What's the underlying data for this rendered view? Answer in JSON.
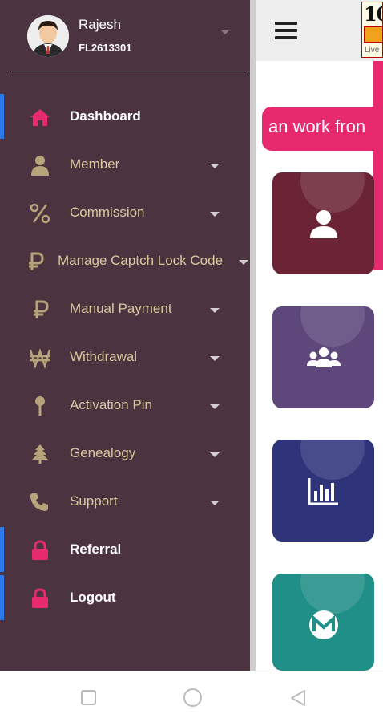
{
  "user": {
    "name": "Rajesh",
    "id": "FL2613301"
  },
  "marquee_text": "an work fron",
  "logo": {
    "text": "10",
    "subtext": "Live"
  },
  "menu": [
    {
      "label": "Dashboard",
      "icon": "home-icon",
      "active": true,
      "caret": false
    },
    {
      "label": "Member",
      "icon": "user-icon",
      "active": false,
      "caret": true
    },
    {
      "label": "Commission",
      "icon": "percent-icon",
      "active": false,
      "caret": true
    },
    {
      "label": "Manage Captch Lock Code",
      "icon": "ruble-icon",
      "active": false,
      "caret": true
    },
    {
      "label": "Manual Payment",
      "icon": "ruble-icon",
      "active": false,
      "caret": true
    },
    {
      "label": "Withdrawal",
      "icon": "won-icon",
      "active": false,
      "caret": true
    },
    {
      "label": "Activation Pin",
      "icon": "pin-icon",
      "active": false,
      "caret": true
    },
    {
      "label": "Genealogy",
      "icon": "tree-icon",
      "active": false,
      "caret": true
    },
    {
      "label": "Support",
      "icon": "phone-icon",
      "active": false,
      "caret": true
    },
    {
      "label": "Referral",
      "icon": "lock-icon",
      "active": true,
      "caret": false
    },
    {
      "label": "Logout",
      "icon": "lock-icon",
      "active": true,
      "caret": false
    }
  ],
  "colors": {
    "drawer_bg": "#4b343f",
    "accent_pink": "#e72a6d",
    "menu_text": "#d8c79e",
    "active_bar": "#2d7be8"
  }
}
